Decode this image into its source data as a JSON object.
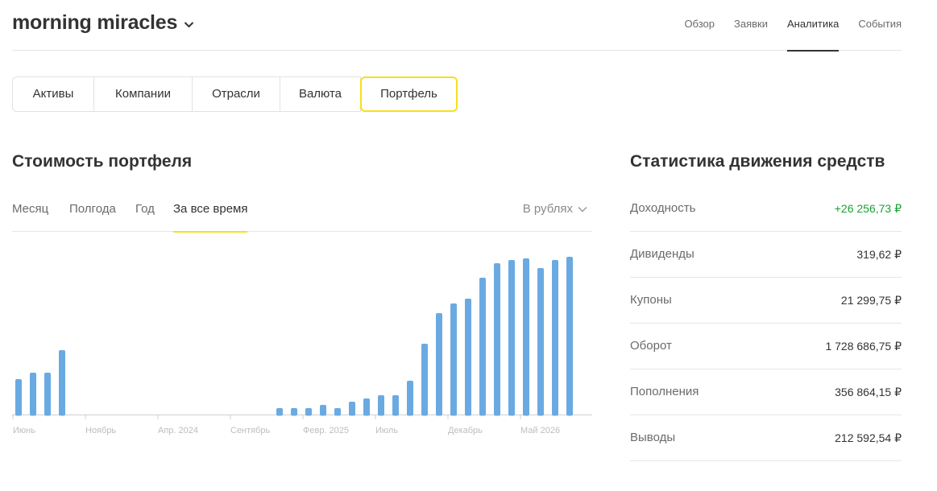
{
  "header": {
    "title": "morning miracles",
    "nav": [
      {
        "label": "Обзор",
        "active": false
      },
      {
        "label": "Заявки",
        "active": false
      },
      {
        "label": "Аналитика",
        "active": true
      },
      {
        "label": "События",
        "active": false
      }
    ]
  },
  "tabs": [
    {
      "label": "Активы",
      "active": false
    },
    {
      "label": "Компании",
      "active": false
    },
    {
      "label": "Отрасли",
      "active": false
    },
    {
      "label": "Валюта",
      "active": false
    },
    {
      "label": "Портфель",
      "active": true
    }
  ],
  "portfolio": {
    "title": "Стоимость портфеля",
    "periods": [
      {
        "label": "Месяц",
        "active": false
      },
      {
        "label": "Полгода",
        "active": false
      },
      {
        "label": "Год",
        "active": false
      },
      {
        "label": "За все время",
        "active": true
      }
    ],
    "currency_label": "В рублях"
  },
  "stats": {
    "title": "Статистика движения средств",
    "rows": [
      {
        "label": "Доходность",
        "value": "+26 256,73 ₽",
        "positive": true
      },
      {
        "label": "Дивиденды",
        "value": "319,62 ₽",
        "positive": false
      },
      {
        "label": "Купоны",
        "value": "21 299,75 ₽",
        "positive": false
      },
      {
        "label": "Оборот",
        "value": "1 728 686,75 ₽",
        "positive": false
      },
      {
        "label": "Пополнения",
        "value": "356 864,15 ₽",
        "positive": false
      },
      {
        "label": "Выводы",
        "value": "212 592,54 ₽",
        "positive": false
      }
    ]
  },
  "colors": {
    "accent": "#f7df1e",
    "bar": "#6aaae2",
    "positive": "#1aa033"
  },
  "chart_data": {
    "type": "bar",
    "x_ticks": [
      "Июнь",
      "Ноябрь",
      "Апр. 2024",
      "Сентябрь",
      "Февр. 2025",
      "Июль",
      "Декабрь",
      "Май 2026"
    ],
    "values": [
      22,
      26,
      26,
      40,
      0,
      0,
      0,
      0,
      0,
      0,
      0,
      0,
      0,
      0,
      0,
      0,
      0,
      0,
      4,
      4,
      4,
      6,
      4,
      8,
      10,
      12,
      12,
      21,
      44,
      63,
      69,
      72,
      85,
      94,
      96,
      97,
      91,
      96,
      98
    ],
    "ylim": [
      0,
      100
    ],
    "grid": false,
    "legend": "none"
  }
}
